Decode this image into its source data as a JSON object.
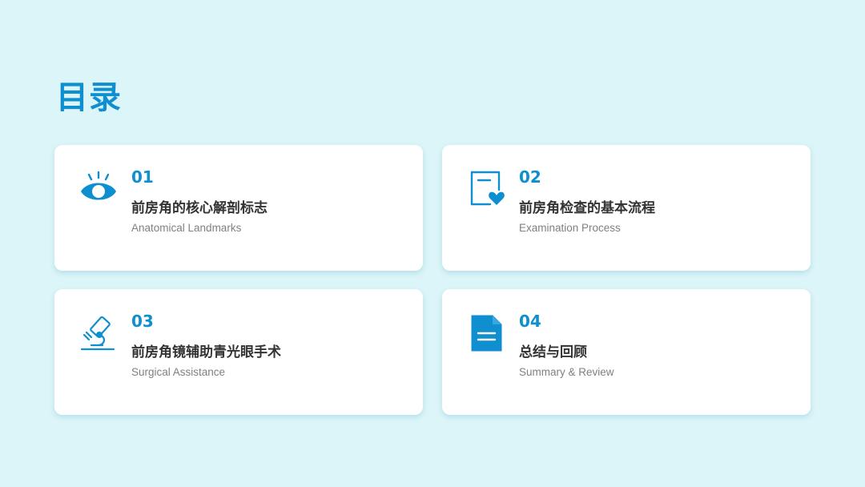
{
  "page": {
    "title": "目录",
    "accent_color": "#0f8fd0",
    "background_color": "#dcf5f8"
  },
  "cards": [
    {
      "number": "01",
      "title": "前房角的核心解剖标志",
      "subtitle": "Anatomical Landmarks",
      "icon": "eye-icon"
    },
    {
      "number": "02",
      "title": "前房角检查的基本流程",
      "subtitle": "Examination Process",
      "icon": "heart-document-icon"
    },
    {
      "number": "03",
      "title": "前房角镜辅助青光眼手术",
      "subtitle": "Surgical Assistance",
      "icon": "microscope-icon"
    },
    {
      "number": "04",
      "title": "总结与回顾",
      "subtitle": "Summary & Review",
      "icon": "document-icon"
    }
  ]
}
